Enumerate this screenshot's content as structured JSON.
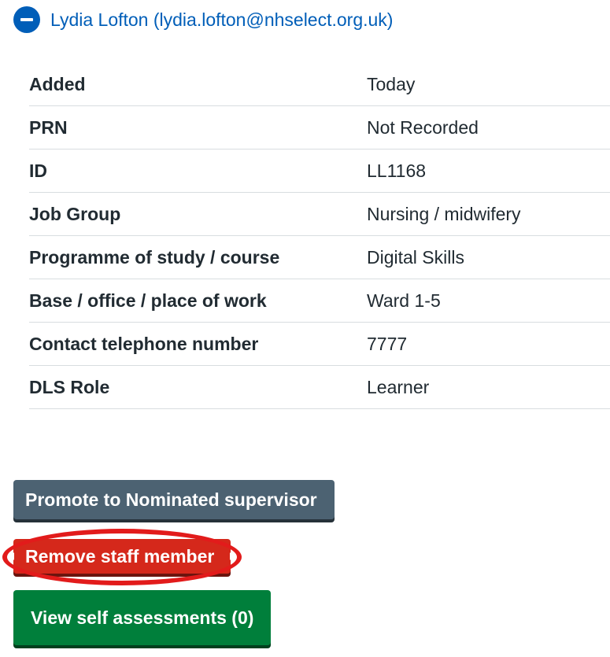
{
  "expander": {
    "title": "Lydia Lofton (lydia.lofton@nhselect.org.uk)",
    "icon": "minus-circle-icon"
  },
  "summary": {
    "rows": [
      {
        "key": "Added",
        "value": "Today"
      },
      {
        "key": "PRN",
        "value": "Not Recorded"
      },
      {
        "key": "ID",
        "value": "LL1168"
      },
      {
        "key": "Job Group",
        "value": "Nursing / midwifery"
      },
      {
        "key": "Programme of study / course",
        "value": "Digital Skills"
      },
      {
        "key": "Base / office / place of work",
        "value": "Ward 1-5"
      },
      {
        "key": "Contact telephone number",
        "value": "7777"
      },
      {
        "key": "DLS Role",
        "value": "Learner"
      }
    ]
  },
  "buttons": {
    "promote": "Promote to Nominated supervisor",
    "remove": "Remove staff member",
    "view_assessments": "View self assessments (0)"
  },
  "colors": {
    "link_blue": "#005eb8",
    "secondary_grey": "#4c6272",
    "warning_red": "#d5281b",
    "primary_green": "#007f3b",
    "highlight_red": "#e21b1b"
  }
}
